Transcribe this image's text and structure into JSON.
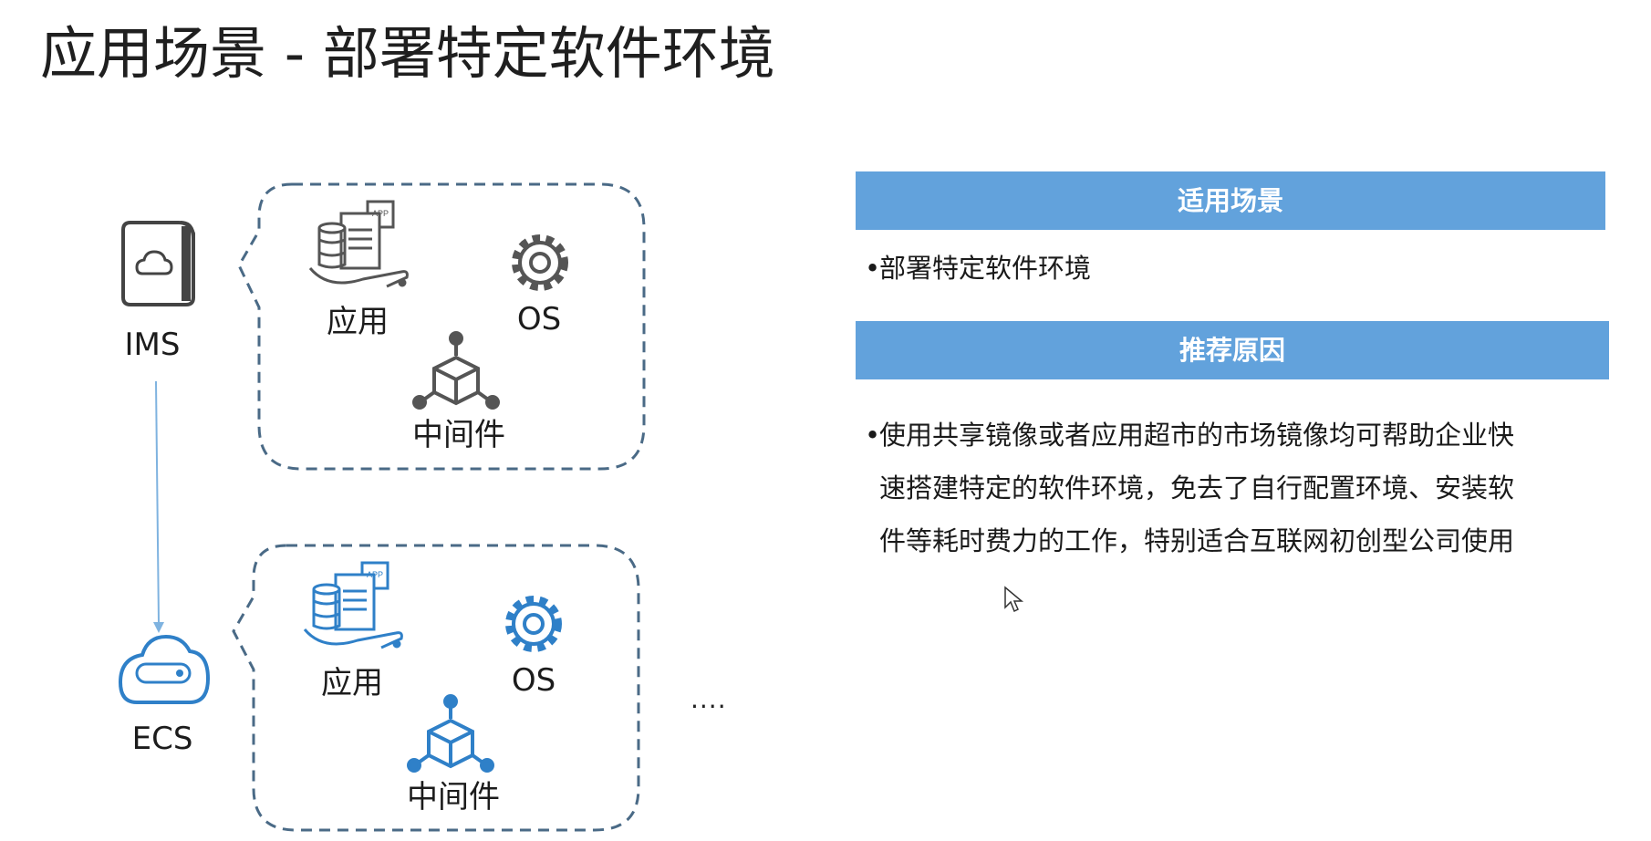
{
  "title": "应用场景 - 部署特定软件环境",
  "diagram": {
    "ims_label": "IMS",
    "ecs_label": "ECS",
    "top_group": {
      "app_label": "应用",
      "os_label": "OS",
      "middleware_label": "中间件",
      "app_badge": "APP"
    },
    "bottom_group": {
      "app_label": "应用",
      "os_label": "OS",
      "middleware_label": "中间件",
      "app_badge": "APP"
    },
    "ellipsis": "....",
    "colors": {
      "gray_icon": "#555555",
      "blue_icon": "#2f80c8",
      "dashed_border": "#4a6a86",
      "arrow": "#7fb3e0"
    }
  },
  "panel": {
    "scenario_header": "适用场景",
    "scenario_item": "部署特定软件环境",
    "reason_header": "推荐原因",
    "reason_lines": [
      "使用共享镜像或者应用超市的市场镜像均可帮助企业快",
      "速搭建特定的软件环境，免去了自行配置环境、安装软",
      "件等耗时费力的工作，特别适合互联网初创型公司使用"
    ],
    "bullet": "•",
    "header_color": "#62a2dc"
  }
}
